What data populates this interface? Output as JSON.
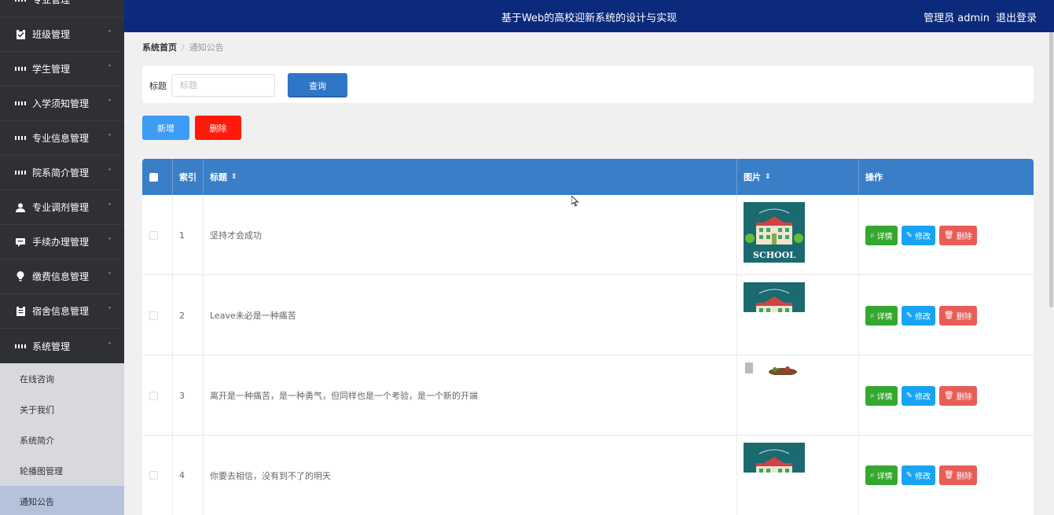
{
  "header": {
    "title": "基于Web的高校迎新系统的设计与实现",
    "admin_label": "管理员 admin",
    "logout_label": "退出登录"
  },
  "sidebar": {
    "items": [
      {
        "label": "专业管理",
        "icon": "grid-icon",
        "chevron": "˅"
      },
      {
        "label": "班级管理",
        "icon": "clipboard-icon",
        "chevron": "˅"
      },
      {
        "label": "学生管理",
        "icon": "grid-icon",
        "chevron": "˅"
      },
      {
        "label": "入学须知管理",
        "icon": "grid-icon",
        "chevron": "˅"
      },
      {
        "label": "专业信息管理",
        "icon": "grid-icon",
        "chevron": "˅"
      },
      {
        "label": "院系简介管理",
        "icon": "grid-icon",
        "chevron": "˅"
      },
      {
        "label": "专业调剂管理",
        "icon": "user-icon",
        "chevron": "˅"
      },
      {
        "label": "手续办理管理",
        "icon": "chat-icon",
        "chevron": "˅"
      },
      {
        "label": "缴费信息管理",
        "icon": "bulb-icon",
        "chevron": "˅"
      },
      {
        "label": "宿舍信息管理",
        "icon": "clipboard-icon",
        "chevron": "˅"
      },
      {
        "label": "系统管理",
        "icon": "grid-icon",
        "chevron": "˄"
      }
    ],
    "submenu": [
      {
        "label": "在线咨询"
      },
      {
        "label": "关于我们"
      },
      {
        "label": "系统简介"
      },
      {
        "label": "轮播图管理"
      },
      {
        "label": "通知公告"
      }
    ]
  },
  "breadcrumb": {
    "home": "系统首页",
    "separator": "/",
    "current": "通知公告"
  },
  "search": {
    "label": "标题",
    "placeholder": "标题",
    "value": "",
    "button": "查询"
  },
  "actions": {
    "add": "新增",
    "delete": "删除"
  },
  "table": {
    "headers": {
      "index": "索引",
      "title": "标题",
      "image": "图片",
      "ops": "操作"
    },
    "sort_icon": "⇕",
    "rows": [
      {
        "index": "1",
        "title": "坚持才会成功",
        "thumb_text": "SCHOOL"
      },
      {
        "index": "2",
        "title": "Leave未必是一种痛苦",
        "thumb_text": ""
      },
      {
        "index": "3",
        "title": "离开是一种痛苦，是一种勇气，但同样也是一个考验，是一个新的开端",
        "thumb_text": ""
      },
      {
        "index": "4",
        "title": "你要去相信，没有到不了的明天",
        "thumb_text": ""
      }
    ],
    "ops": {
      "detail": "详情",
      "edit": "修改",
      "remove": "删除"
    }
  },
  "colors": {
    "header_bg": "#0b2a7c",
    "sidebar_bg": "#2f3033",
    "table_head": "#3a7ec7",
    "add": "#3c9cf6",
    "delete": "#ff1a0a"
  }
}
